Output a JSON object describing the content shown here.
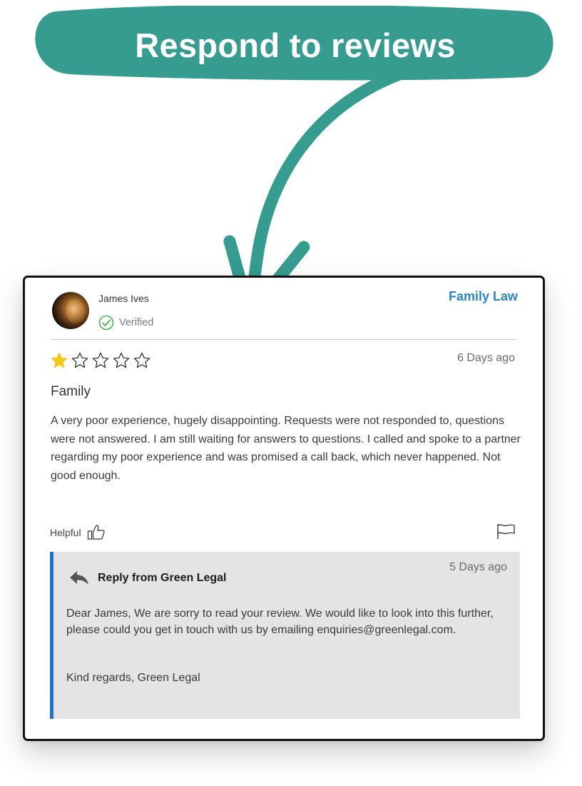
{
  "banner": {
    "text": "Respond to reviews"
  },
  "colors": {
    "accent": "#369c8f",
    "link": "#2b86c4",
    "reply_bar": "#1f74c9",
    "star": "#f5c518",
    "verified": "#4caf50"
  },
  "review": {
    "author": "James Ives",
    "verified_label": "Verified",
    "category": "Family Law",
    "rating": 1,
    "max_rating": 5,
    "date": "6 Days ago",
    "title": "Family",
    "body": "A very poor experience, hugely disappointing. Requests were not responded to, questions were not answered. I am still waiting for answers to questions. I called and spoke to a partner regarding my poor experience and was promised a call back, which never happened. Not good enough.",
    "helpful_label": "Helpful",
    "icons": {
      "helpful": "thumbs-up-icon",
      "report": "flag-icon",
      "verified": "check-circle-icon",
      "reply": "reply-arrow-icon"
    }
  },
  "reply": {
    "heading": "Reply from Green Legal",
    "date": "5 Days ago",
    "body": "Dear James, We are sorry to read your review. We would like to look into this further, please could you get in touch with us by emailing enquiries@greenlegal.com.",
    "signoff": "Kind regards, Green Legal"
  }
}
